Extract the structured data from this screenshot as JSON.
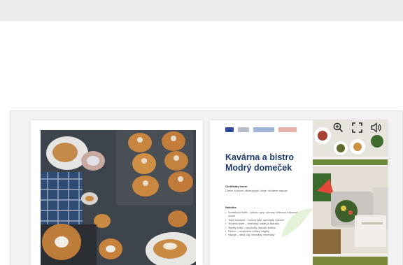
{
  "viewer": {
    "right_page": {
      "title_line1": "Kavárna a bistro",
      "title_line2": "Modrý domeček",
      "section1_heading": "Certifikáty lorem",
      "section1_text": "Lorem a ipsum občerstvení, kapr i studené nápoje",
      "section2_heading": "Nabídka",
      "menu_items": [
        "Snídaňový bufet – pečivo, sýry, uzeniny, zelenina a sezónní ovoce",
        "Teplá kuchyně – hotová jídla, speciality, dušené",
        "Studený bufet – chlebíčky, saláty a zákusky",
        "Sladký bufet – moučníky, domácí koláče",
        "Pečivo – rozpečené rohlíky, bagety",
        "Nápoje – káva, čaj, limonády, minerálky"
      ]
    },
    "toolbar": {
      "zoom_icon": "zoom-in-icon",
      "fullscreen_icon": "fullscreen-icon",
      "sound_icon": "speaker-icon"
    }
  },
  "colors": {
    "title": "#1f3b6e",
    "band": "#ececee",
    "viewer_bg": "#f2f2f3"
  }
}
